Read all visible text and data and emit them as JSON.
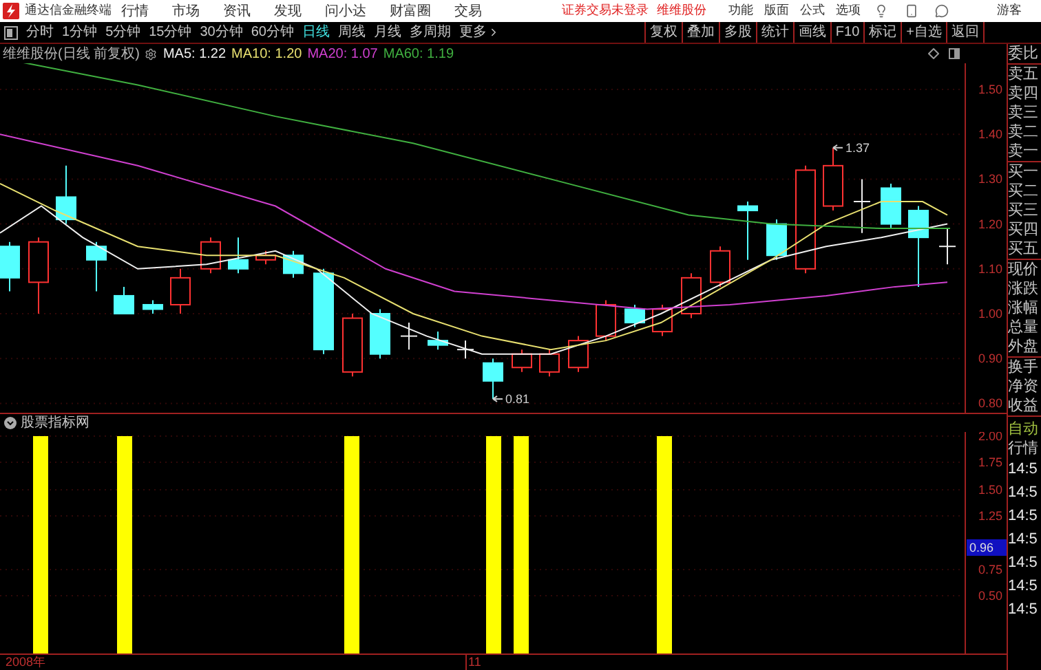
{
  "title_bar": {
    "app_name": "通达信金融终端",
    "menu": [
      "行情",
      "市场",
      "资讯",
      "发现",
      "问小达",
      "财富圈",
      "交易"
    ],
    "notice": "证券交易未登录",
    "stock": "维维股份",
    "tools": [
      "功能",
      "版面",
      "公式",
      "选项"
    ],
    "user": "游客"
  },
  "period_tabs": [
    {
      "label": "分时",
      "selected": false
    },
    {
      "label": "1分钟",
      "selected": false
    },
    {
      "label": "5分钟",
      "selected": false
    },
    {
      "label": "15分钟",
      "selected": false
    },
    {
      "label": "30分钟",
      "selected": false
    },
    {
      "label": "60分钟",
      "selected": false
    },
    {
      "label": "日线",
      "selected": true
    },
    {
      "label": "周线",
      "selected": false
    },
    {
      "label": "月线",
      "selected": false
    },
    {
      "label": "多周期",
      "selected": false
    }
  ],
  "more_label": "更多",
  "chart_tools": [
    "复权",
    "叠加",
    "多股",
    "统计",
    "画线",
    "F10",
    "标记",
    "+自选",
    "返回"
  ],
  "main_chart": {
    "title": "维维股份(日线 前复权)",
    "indicators": [
      {
        "label": "MA5: 1.22",
        "color": "#f0f0f0"
      },
      {
        "label": "MA10: 1.20",
        "color": "#e8e070"
      },
      {
        "label": "MA20: 1.07",
        "color": "#d040d0"
      },
      {
        "label": "MA60: 1.19",
        "color": "#40b040"
      }
    ],
    "price_labels": [
      "1.50",
      "1.40",
      "1.30",
      "1.20",
      "1.10",
      "1.00",
      "0.90",
      "0.80"
    ],
    "high_marker": "1.37",
    "low_marker": "0.81"
  },
  "indicator_panel": {
    "title": "股票指标网",
    "axis_labels": [
      "2.00",
      "1.75",
      "1.50",
      "1.25",
      "0.75",
      "0.50"
    ],
    "current_value": "0.96"
  },
  "date_axis": [
    "2008年",
    "11"
  ],
  "quote_panel": {
    "groups": [
      [
        "委比"
      ],
      [
        "卖五",
        "卖四",
        "卖三",
        "卖二",
        "卖一"
      ],
      [
        "买一",
        "买二",
        "买三",
        "买四",
        "买五"
      ],
      [
        "现价",
        "涨跌",
        "涨幅",
        "总量",
        "外盘"
      ],
      [
        "换手",
        "净资",
        "收益"
      ]
    ],
    "mode": "自动",
    "section": "行情",
    "times": [
      "14:5",
      "14:5",
      "14:5",
      "14:5",
      "14:5",
      "14:5",
      "14:5"
    ]
  }
}
